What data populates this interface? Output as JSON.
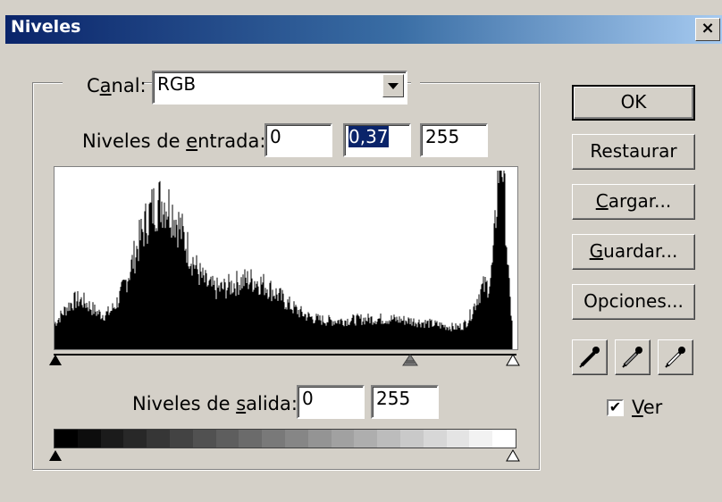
{
  "window": {
    "title": "Niveles",
    "close_glyph": "×"
  },
  "channel": {
    "label_pre": "C",
    "label_acc": "a",
    "label_post": "nal:",
    "value": "RGB"
  },
  "input_levels": {
    "label_pre": "Niveles de ",
    "label_acc": "e",
    "label_post": "ntrada:",
    "black": "0",
    "gamma": "0,37",
    "white": "255"
  },
  "output_levels": {
    "label_pre": "Niveles de ",
    "label_acc": "s",
    "label_post": "alida:",
    "black": "0",
    "white": "255"
  },
  "buttons": {
    "ok": "OK",
    "reset": "Restaurar",
    "load_acc": "C",
    "load_rest": "argar...",
    "save_acc": "G",
    "save_rest": "uardar...",
    "options": "Opciones..."
  },
  "eyedroppers": [
    "black-eyedropper-icon",
    "gray-eyedropper-icon",
    "white-eyedropper-icon"
  ],
  "preview": {
    "label_acc": "V",
    "label_rest": "er",
    "checked": true,
    "check_glyph": "✔"
  },
  "sliders": {
    "input": {
      "black": 0,
      "gray": 0.69,
      "white": 1.0
    },
    "output": {
      "black": 0,
      "white": 1.0
    }
  }
}
